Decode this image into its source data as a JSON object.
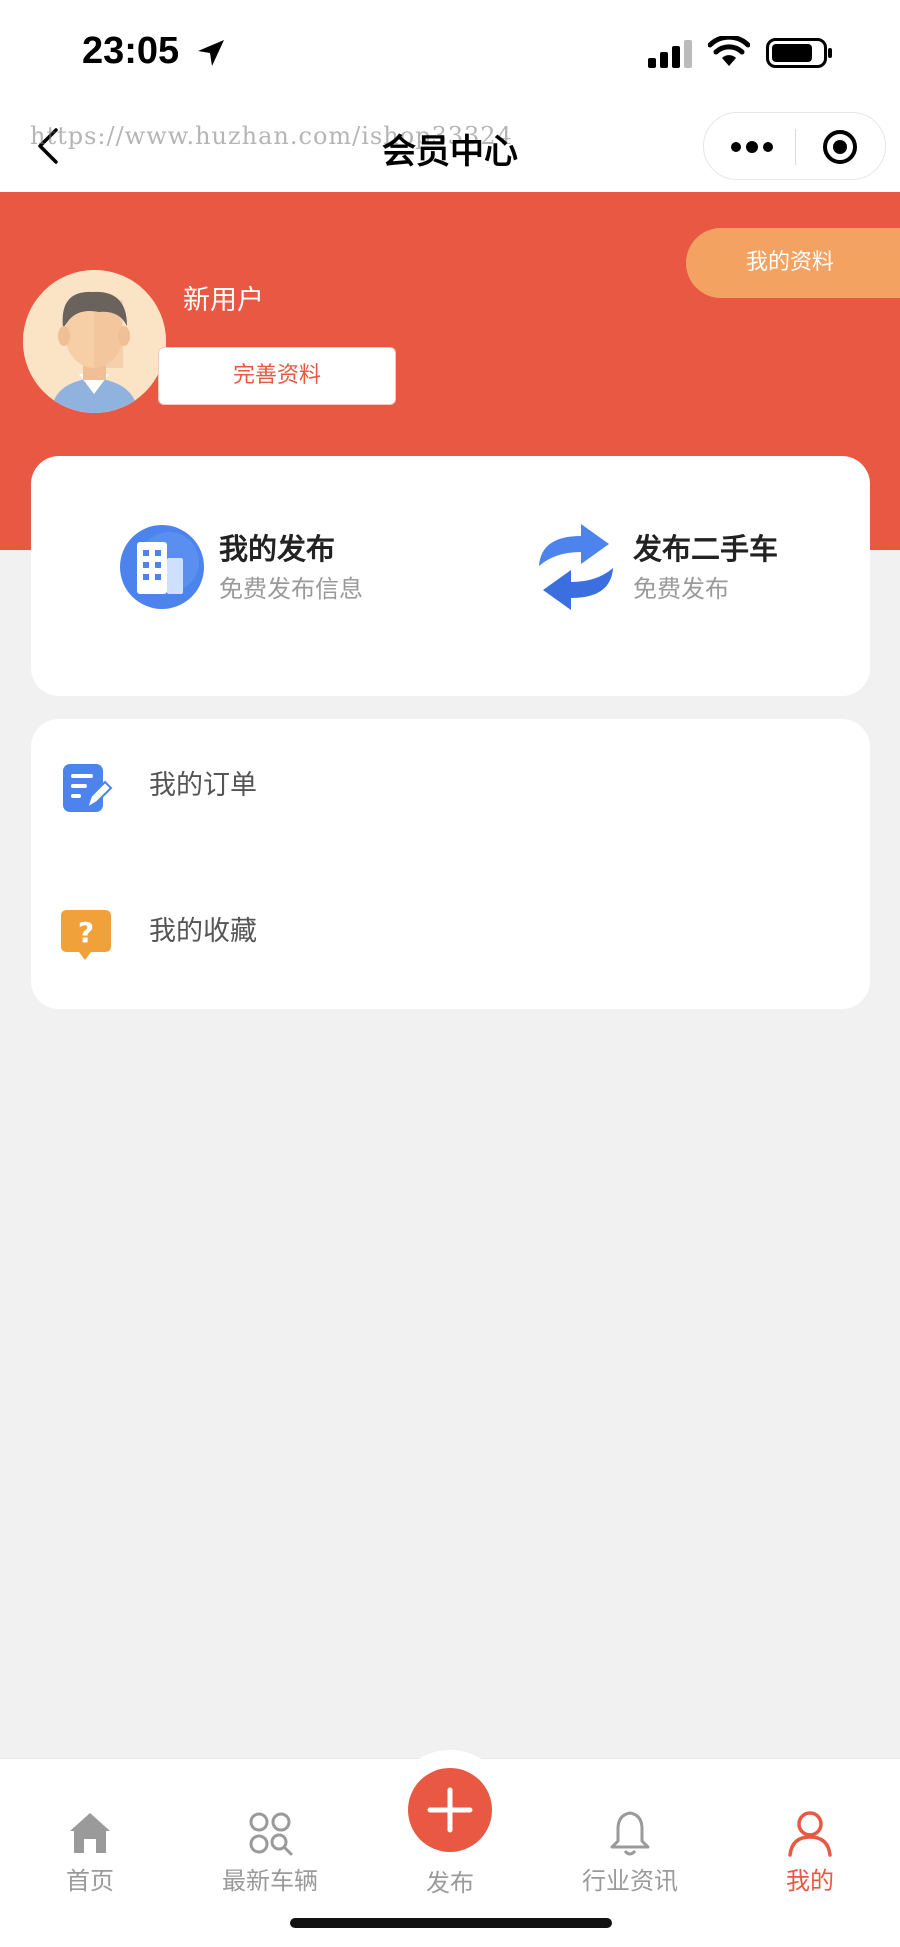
{
  "status_bar": {
    "time": "23:05"
  },
  "nav": {
    "title": "会员中心",
    "watermark": "https://www.huzhan.com/ishop33324"
  },
  "header": {
    "username": "新用户",
    "edit_profile_label": "完善资料",
    "my_profile_label": "我的资料",
    "accent_color": "#e85842"
  },
  "publish_card": {
    "items": [
      {
        "title": "我的发布",
        "subtitle": "免费发布信息",
        "icon": "building-icon"
      },
      {
        "title": "发布二手车",
        "subtitle": "免费发布",
        "icon": "refresh-arrows-icon"
      }
    ]
  },
  "menu": {
    "items": [
      {
        "label": "我的订单",
        "icon": "edit-document-icon"
      },
      {
        "label": "我的收藏",
        "icon": "question-bubble-icon"
      }
    ]
  },
  "tab_bar": {
    "items": [
      {
        "label": "首页",
        "icon": "home-icon",
        "active": false
      },
      {
        "label": "最新车辆",
        "icon": "grid-search-icon",
        "active": false
      },
      {
        "label": "发布",
        "icon": "plus-icon",
        "active": false
      },
      {
        "label": "行业资讯",
        "icon": "bell-icon",
        "active": false
      },
      {
        "label": "我的",
        "icon": "user-icon",
        "active": true
      }
    ]
  }
}
